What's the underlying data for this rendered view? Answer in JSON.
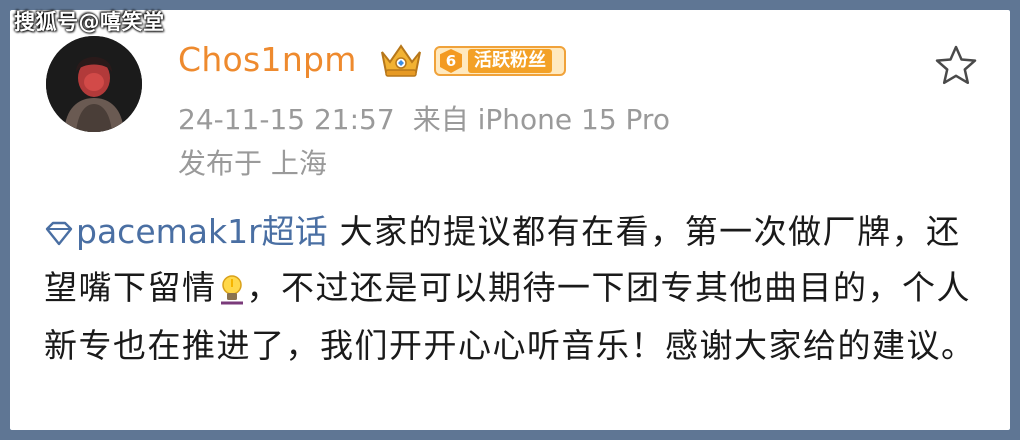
{
  "watermark": "搜狐号@嘻笑堂",
  "post": {
    "username": "Chos1npm",
    "fan_badge": {
      "level": "6",
      "label": "活跃粉丝"
    },
    "timestamp": "24-11-15 21:57",
    "source": "来自 iPhone 15 Pro",
    "location": "发布于 上海",
    "topic": "pacemak1r超话",
    "text_1": "大家的提议都有在看，第一次做厂牌，还望嘴下留情",
    "text_2": "，不过还是可以期待一下团专其他曲目的，个人新专也在推进了，我们开开心心听音乐！感谢大家给的建议。"
  },
  "colors": {
    "username": "#ee8a2e",
    "topic": "#4a6fa3",
    "meta": "#9a9a9a",
    "background": "#5f7694"
  },
  "icons": {
    "topic": "diamond-topic-icon",
    "favorite": "star-outline-icon",
    "emoji": "lightbulb-emoji-icon",
    "vip": "crown-badge-icon"
  }
}
